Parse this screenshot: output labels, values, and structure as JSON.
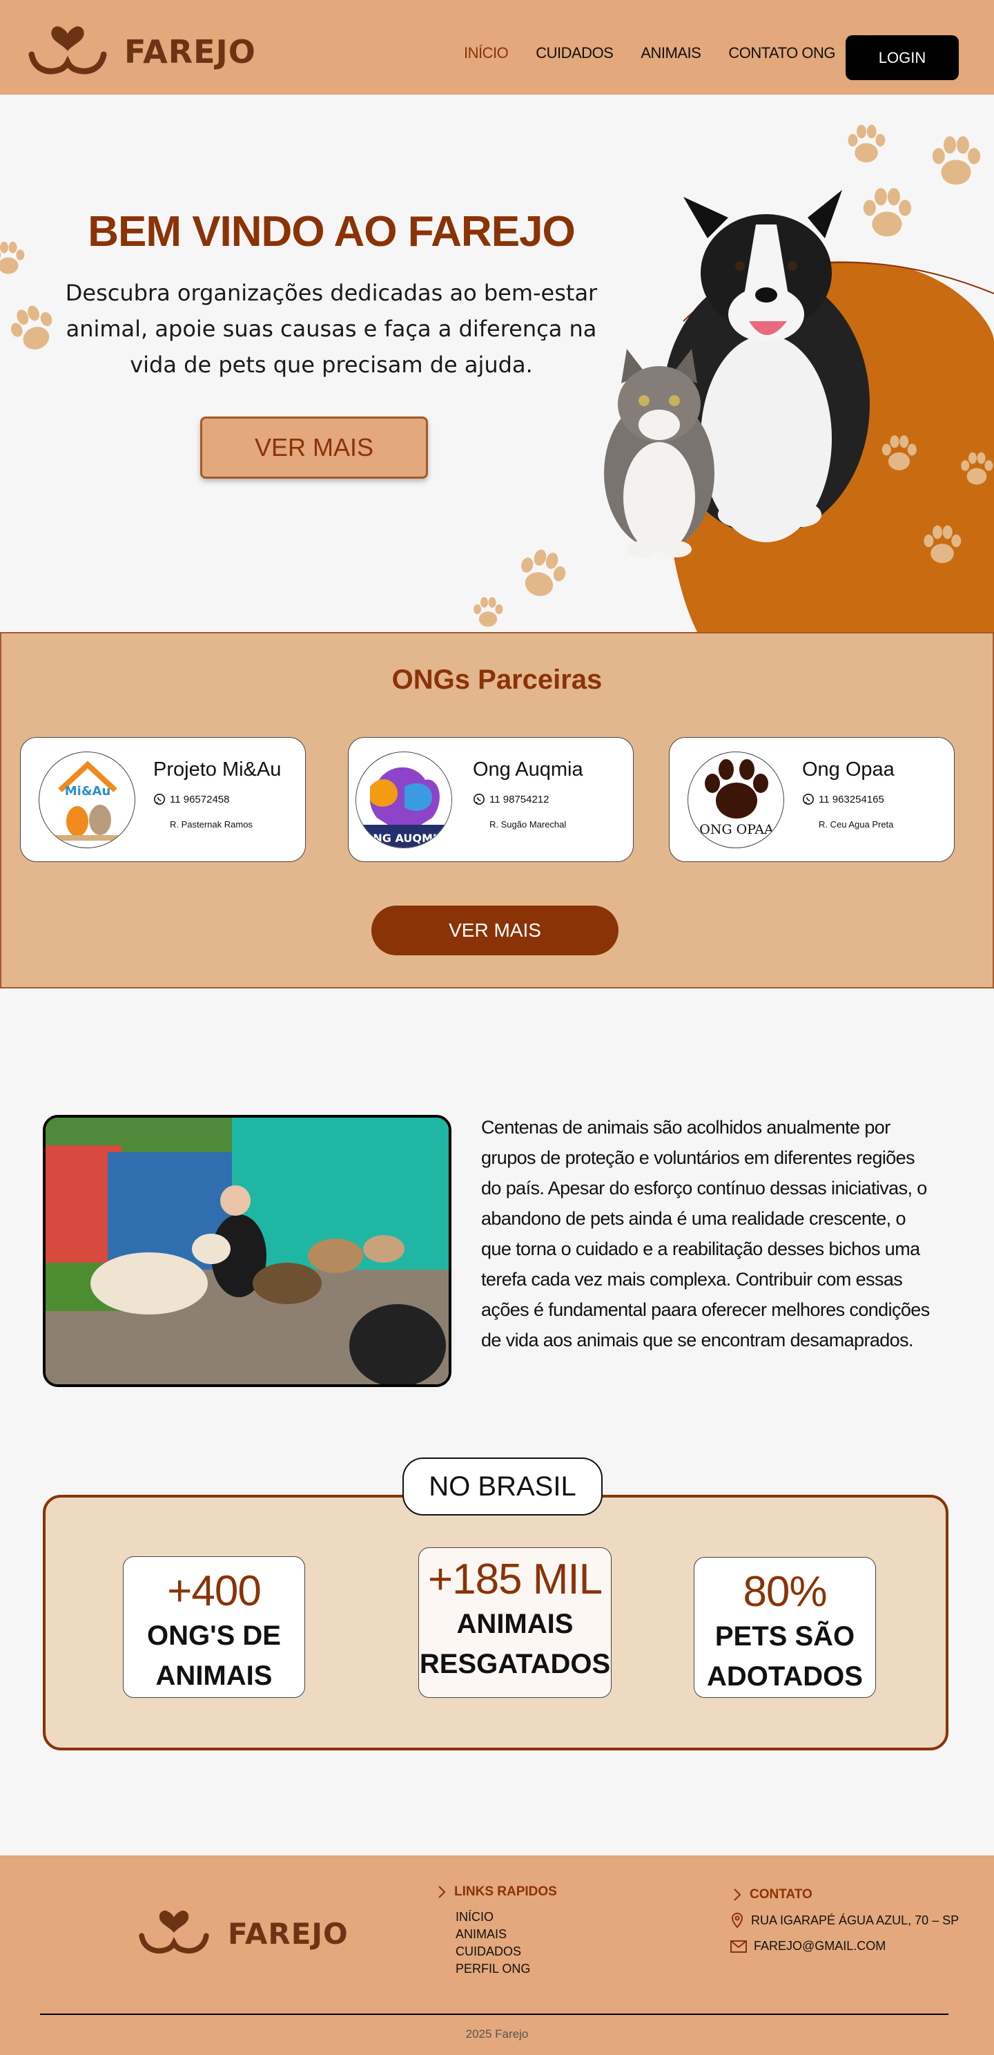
{
  "header": {
    "logo_text": "FAREJO",
    "nav": [
      {
        "label": "INÍCIO",
        "active": true
      },
      {
        "label": "CUIDADOS",
        "active": false
      },
      {
        "label": "ANIMAIS",
        "active": false
      },
      {
        "label": "CONTATO ONG",
        "active": false
      }
    ],
    "login_label": "LOGIN"
  },
  "hero": {
    "title": "BEM VINDO AO FAREJO",
    "subtitle": "Descubra organizações dedicadas ao bem-estar animal, apoie suas causas e faça a diferença na vida de pets que precisam de ajuda.",
    "button_label": "VER MAIS"
  },
  "partners": {
    "title": "ONGs Parceiras",
    "cards": [
      {
        "name": "Projeto Mi&Au",
        "phone": "11 96572458",
        "address": "R. Pasternak Ramos",
        "logo_text": "Mi&Au"
      },
      {
        "name": "Ong Auqmia",
        "phone": "11 98754212",
        "address": "R. Sugão Marechal",
        "logo_text": "ONG AUQMIA"
      },
      {
        "name": "Ong Opaa",
        "phone": "11 963254165",
        "address": "R. Ceu Agua Preta",
        "logo_text": "ONG OPAA"
      }
    ],
    "button_label": "VER MAIS"
  },
  "about": {
    "text": "Centenas de animais são acolhidos anualmente por grupos de proteção e voluntários em diferentes regiões do país. Apesar do esforço contínuo dessas iniciativas, o abandono de pets ainda é uma realidade crescente, o que torna o cuidado e a reabilitação desses bichos uma terefa cada vez mais complexa. Contribuir com essas ações é fundamental paara oferecer melhores condições de vida aos animais que se encontram desamaprados."
  },
  "stats": {
    "label": "NO BRASIL",
    "items": [
      {
        "value": "+400",
        "line1": "ONG'S DE",
        "line2": "ANIMAIS"
      },
      {
        "value": "+185 MIL",
        "line1": "ANIMAIS",
        "line2": "RESGATADOS"
      },
      {
        "value": "80%",
        "line1": "PETS SÃO",
        "line2": "ADOTADOS"
      }
    ]
  },
  "footer": {
    "logo_text": "FAREJO",
    "links_title": "LINKS RAPIDOS",
    "links": [
      "INÍCIO",
      "ANIMAIS",
      "CUIDADOS",
      "PERFIL ONG"
    ],
    "contact_title": "CONTATO",
    "address": "RUA IGARAPÉ ÁGUA AZUL, 70 – SP",
    "email": "FAREJO@GMAIL.COM",
    "copyright": "2025 Farejo"
  },
  "colors": {
    "header_bg": "#e3a87b",
    "brand_dark": "#8a3306",
    "partners_bg": "#e3b78d",
    "stats_bg": "#eddac1",
    "hero_orange": "#c96b11",
    "paw": "#e2b888"
  },
  "icons": [
    "dog-face-logo-icon",
    "paw-icon",
    "whatsapp-icon",
    "chevron-right-icon",
    "location-pin-icon",
    "mail-icon"
  ]
}
